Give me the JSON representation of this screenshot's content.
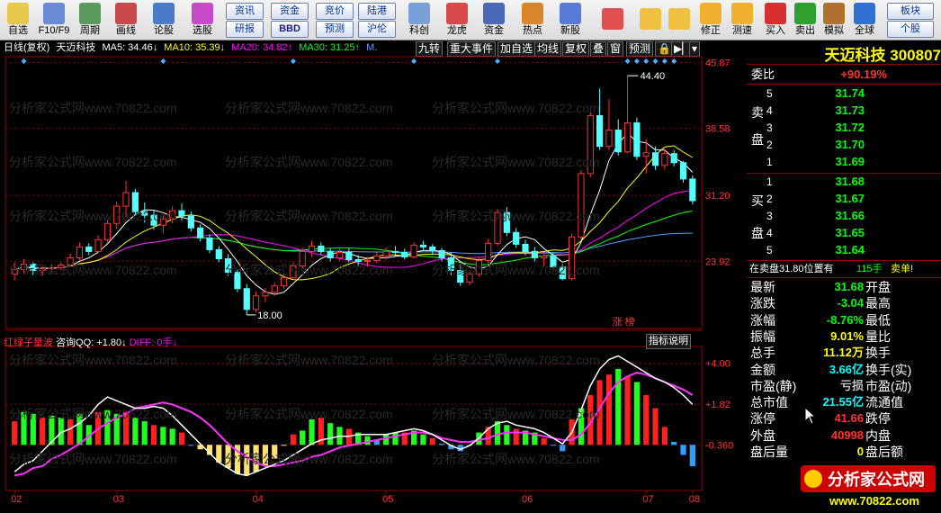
{
  "toolbar": {
    "items": [
      {
        "label": "自选",
        "icon": "grid-icon"
      },
      {
        "label": "F10/F9",
        "icon": "f10-icon"
      },
      {
        "label": "周期",
        "icon": "cycle-icon"
      },
      {
        "label": "画线",
        "icon": "pen-icon"
      },
      {
        "label": "论股",
        "icon": "discuss-icon"
      },
      {
        "label": "选股",
        "icon": "select-stock-icon"
      },
      {
        "label": "科创",
        "icon": "kechuang-icon"
      },
      {
        "label": "龙虎",
        "icon": "dragon-tiger-icon"
      },
      {
        "label": "资金",
        "icon": "pe-icon"
      },
      {
        "label": "热点",
        "icon": "hot-icon"
      },
      {
        "label": "新股",
        "icon": "ipo-icon"
      }
    ],
    "buttons_top": [
      "资讯",
      "资金",
      "竞价",
      "陆港"
    ],
    "buttons_bottom": [
      "研报",
      "BBD",
      "预测",
      "沪伦"
    ],
    "right_items": [
      {
        "label": "修正",
        "icon": "revise-icon"
      },
      {
        "label": "测速",
        "icon": "speed-icon"
      },
      {
        "label": "买入",
        "icon": "buy-icon"
      },
      {
        "label": "卖出",
        "icon": "sell-icon"
      },
      {
        "label": "模拟",
        "icon": "hammer-icon"
      },
      {
        "label": "全球",
        "icon": "globe-icon"
      }
    ],
    "right_buttons": [
      "板块",
      "个股"
    ]
  },
  "chart_header": {
    "period": "日线(复权)",
    "name": "天迈科技",
    "ma5": "MA5: 34.46↓",
    "ma10": "MA10: 35.39↓",
    "ma20": "MA20: 34.82↑",
    "ma30": "MA30: 31.25↑",
    "more": "M.",
    "tabs": [
      "九转",
      "重大事件",
      "加自选",
      "均线",
      "复权",
      "叠",
      "窗",
      "预测",
      "🔒",
      "▶▏",
      "▾"
    ]
  },
  "indicator_header": {
    "name": "红绿子量波",
    "qq": "咨询QQ: +1.80↓",
    "diff": "DIFF: 0手↓",
    "explain": "指标说明"
  },
  "colors": {
    "up": "#ff3232",
    "down": "#54ffff",
    "ma5": "#ffffff",
    "ma10": "#ffff00",
    "ma20": "#ff00ff",
    "ma30": "#00ff00",
    "ma60": "#5599ff",
    "grid": "#8b0000",
    "axis_text": "#ff3232"
  },
  "chart_data": [
    {
      "type": "candlestick",
      "title": "",
      "y_ticks": [
        45.87,
        38.58,
        31.2,
        23.92
      ],
      "ylim": [
        16.5,
        46.5
      ],
      "x_ticks": [
        "02",
        "03",
        "04",
        "05",
        "06",
        "07",
        "08"
      ],
      "annotations": [
        {
          "text": "44.40",
          "value": 44.4
        },
        {
          "text": "18.00",
          "value": 18.0
        },
        {
          "text": "涨 榜",
          "value": 0
        }
      ],
      "candles": [
        [
          22.5,
          23.8,
          21.8,
          23.0
        ],
        [
          23.0,
          24.2,
          22.6,
          23.6
        ],
        [
          23.6,
          23.8,
          22.4,
          22.9
        ],
        [
          22.9,
          23.4,
          22.3,
          23.1
        ],
        [
          23.1,
          23.6,
          22.7,
          23.2
        ],
        [
          23.2,
          23.8,
          22.9,
          23.5
        ],
        [
          23.5,
          24.8,
          23.3,
          24.3
        ],
        [
          24.3,
          26.0,
          24.0,
          25.5
        ],
        [
          25.5,
          25.9,
          24.6,
          25.0
        ],
        [
          25.0,
          26.8,
          24.8,
          26.3
        ],
        [
          26.3,
          28.5,
          26.0,
          28.1
        ],
        [
          28.1,
          30.5,
          27.5,
          30.0
        ],
        [
          30.0,
          32.8,
          28.8,
          31.5
        ],
        [
          31.5,
          31.9,
          29.0,
          29.4
        ],
        [
          29.4,
          30.4,
          28.2,
          29.0
        ],
        [
          29.0,
          29.6,
          27.4,
          27.9
        ],
        [
          27.9,
          29.0,
          27.0,
          28.6
        ],
        [
          28.6,
          30.0,
          28.1,
          29.5
        ],
        [
          29.5,
          30.3,
          28.4,
          28.9
        ],
        [
          28.9,
          29.4,
          27.2,
          27.6
        ],
        [
          27.6,
          28.0,
          26.1,
          26.5
        ],
        [
          26.5,
          26.9,
          24.8,
          25.2
        ],
        [
          25.2,
          25.6,
          23.8,
          24.2
        ],
        [
          24.2,
          24.7,
          22.3,
          22.7
        ],
        [
          22.7,
          23.0,
          20.5,
          20.9
        ],
        [
          20.9,
          21.4,
          18.0,
          18.6
        ],
        [
          18.6,
          20.6,
          18.3,
          20.1
        ],
        [
          20.1,
          21.0,
          19.4,
          20.5
        ],
        [
          20.5,
          21.6,
          20.1,
          21.2
        ],
        [
          21.2,
          22.5,
          20.9,
          22.1
        ],
        [
          22.1,
          23.8,
          21.9,
          23.4
        ],
        [
          23.4,
          25.4,
          23.1,
          25.0
        ],
        [
          25.0,
          26.2,
          24.4,
          25.6
        ],
        [
          25.6,
          26.0,
          24.6,
          25.0
        ],
        [
          25.0,
          25.4,
          23.9,
          24.3
        ],
        [
          24.3,
          25.3,
          24.0,
          24.9
        ],
        [
          24.9,
          25.4,
          23.8,
          24.1
        ],
        [
          24.1,
          24.6,
          23.4,
          23.9
        ],
        [
          23.9,
          24.4,
          23.3,
          24.0
        ],
        [
          24.0,
          24.9,
          23.7,
          24.5
        ],
        [
          24.5,
          25.4,
          24.1,
          25.0
        ],
        [
          25.0,
          25.6,
          24.5,
          24.9
        ],
        [
          24.9,
          25.3,
          24.1,
          24.4
        ],
        [
          24.4,
          26.0,
          24.2,
          25.7
        ],
        [
          25.7,
          26.2,
          25.1,
          25.5
        ],
        [
          25.5,
          25.8,
          24.6,
          25.1
        ],
        [
          25.1,
          25.4,
          23.9,
          24.3
        ],
        [
          24.3,
          24.9,
          22.4,
          22.9
        ],
        [
          22.9,
          23.6,
          21.2,
          21.6
        ],
        [
          21.6,
          22.8,
          21.3,
          22.5
        ],
        [
          22.5,
          24.4,
          22.2,
          24.0
        ],
        [
          24.0,
          26.4,
          23.7,
          25.9
        ],
        [
          25.9,
          29.7,
          25.6,
          29.3
        ],
        [
          29.3,
          29.9,
          26.7,
          27.1
        ],
        [
          27.1,
          27.6,
          25.4,
          25.8
        ],
        [
          25.8,
          26.3,
          24.6,
          25.0
        ],
        [
          25.0,
          25.5,
          23.9,
          24.3
        ],
        [
          24.3,
          24.9,
          23.4,
          24.5
        ],
        [
          24.5,
          24.8,
          23.1,
          23.3
        ],
        [
          23.3,
          23.6,
          21.8,
          22.0
        ],
        [
          22.0,
          27.0,
          21.8,
          26.6
        ],
        [
          26.6,
          34.0,
          26.3,
          33.6
        ],
        [
          33.6,
          40.5,
          33.2,
          40.0
        ],
        [
          40.0,
          43.0,
          36.2,
          36.6
        ],
        [
          36.6,
          41.8,
          36.2,
          38.4
        ],
        [
          38.4,
          39.6,
          35.6,
          36.0
        ],
        [
          36.0,
          44.4,
          35.8,
          39.2
        ],
        [
          39.2,
          39.8,
          35.1,
          35.5
        ],
        [
          35.5,
          37.4,
          33.6,
          35.9
        ],
        [
          35.9,
          36.6,
          34.0,
          34.5
        ],
        [
          34.5,
          36.4,
          34.0,
          35.8
        ],
        [
          35.8,
          36.2,
          34.4,
          34.8
        ],
        [
          34.8,
          35.0,
          32.6,
          33.0
        ],
        [
          33.0,
          33.4,
          30.2,
          30.6
        ]
      ]
    },
    {
      "type": "bar",
      "title": "",
      "y_ticks": [
        4.0,
        1.82,
        -0.36
      ],
      "ylim": [
        -2.8,
        4.9
      ],
      "x_ticks": [
        "02",
        "03",
        "04",
        "05",
        "06",
        "07",
        "08"
      ],
      "values": [
        0.9,
        1.4,
        1.3,
        1.1,
        1.2,
        1.1,
        1.0,
        1.3,
        0.7,
        1.4,
        1.5,
        1.3,
        1.4,
        1.1,
        0.9,
        0.7,
        0.6,
        0.5,
        0.3,
        -0.4,
        -0.6,
        -0.9,
        -1.3,
        -1.6,
        -1.9,
        -2.0,
        -1.8,
        -1.5,
        -1.1,
        -0.4,
        0.2,
        0.4,
        1.0,
        1.1,
        0.8,
        0.6,
        0.5,
        0.3,
        0.1,
        -0.1,
        0.2,
        0.3,
        0.3,
        0.4,
        0.2,
        0.0,
        -0.3,
        -0.6,
        -0.7,
        -0.4,
        0.3,
        0.6,
        0.9,
        0.7,
        0.5,
        0.4,
        0.3,
        0.0,
        -0.4,
        -0.7,
        1.0,
        1.6,
        2.3,
        3.1,
        3.4,
        3.7,
        3.3,
        3.0,
        2.3,
        1.6,
        0.6,
        -0.2,
        -0.9,
        -1.5
      ],
      "series": [
        {
          "name": "",
          "values": [
            -2.0,
            -1.9,
            -1.6,
            -1.5,
            -1.1,
            -0.9,
            -0.6,
            -0.3,
            0.1,
            0.5,
            0.8,
            1.1,
            1.3,
            1.6,
            1.7,
            1.8,
            1.9,
            1.8,
            1.6,
            1.4,
            1.1,
            0.7,
            0.2,
            -0.3,
            -0.7,
            -1.0,
            -1.3,
            -1.5,
            -1.5,
            -1.4,
            -1.3,
            -1.2,
            -1.0,
            -0.9,
            -0.7,
            -0.5,
            -0.4,
            -0.3,
            -0.2,
            -0.1,
            0.0,
            0.1,
            0.2,
            0.3,
            0.3,
            0.2,
            0.0,
            -0.1,
            -0.2,
            -0.2,
            -0.1,
            0.0,
            0.2,
            0.3,
            0.3,
            0.3,
            0.2,
            0.1,
            0.0,
            -0.1,
            -0.1,
            0.2,
            0.8,
            1.6,
            2.4,
            3.0,
            3.3,
            3.5,
            3.4,
            3.2,
            3.0,
            2.8,
            2.6,
            2.3
          ]
        },
        {
          "name": "",
          "values": [
            -1.8,
            -1.4,
            -1.2,
            -0.7,
            -0.2,
            0.3,
            0.5,
            0.8,
            1.2,
            1.8,
            2.2,
            2.0,
            1.8,
            1.6,
            1.6,
            1.7,
            1.6,
            1.2,
            0.7,
            0.2,
            -0.3,
            -0.8,
            -1.3,
            -1.6,
            -1.9,
            -2.0,
            -1.8,
            -1.6,
            -1.4,
            -1.2,
            -0.9,
            -0.6,
            -0.3,
            -0.1,
            0.0,
            0.1,
            0.1,
            0.2,
            0.2,
            0.2,
            0.2,
            0.3,
            0.4,
            0.5,
            0.4,
            0.2,
            -0.1,
            -0.4,
            -0.6,
            -0.4,
            0.0,
            0.5,
            0.8,
            0.9,
            0.7,
            0.6,
            0.5,
            0.3,
            0.0,
            -0.3,
            0.3,
            1.5,
            2.8,
            3.7,
            4.2,
            4.4,
            4.1,
            3.8,
            3.5,
            3.2,
            3.0,
            2.7,
            2.3,
            1.8
          ]
        }
      ]
    }
  ],
  "right_panel": {
    "title": "天迈科技 300807",
    "weibi_label": "委比",
    "weibi_value": "+90.19%",
    "sell_side": [
      "卖",
      "盘"
    ],
    "buy_side": [
      "买",
      "盘"
    ],
    "asks": [
      {
        "level": "5",
        "price": "31.74"
      },
      {
        "level": "4",
        "price": "31.73"
      },
      {
        "level": "3",
        "price": "31.72"
      },
      {
        "level": "2",
        "price": "31.70"
      },
      {
        "level": "1",
        "price": "31.69"
      }
    ],
    "bids": [
      {
        "level": "1",
        "price": "31.68"
      },
      {
        "level": "2",
        "price": "31.67"
      },
      {
        "level": "3",
        "price": "31.66"
      },
      {
        "level": "4",
        "price": "31.65"
      },
      {
        "level": "5",
        "price": "31.64"
      }
    ],
    "pending_text": "在卖盘31.80位置有",
    "pending_qty": "115手",
    "pending_tag": "卖单!",
    "stats": [
      {
        "l": "最新",
        "v": "31.68",
        "r": "开盘",
        "c": "#00ff00"
      },
      {
        "l": "涨跌",
        "v": "-3.04",
        "r": "最高",
        "c": "#00ff00"
      },
      {
        "l": "涨幅",
        "v": "-8.76%",
        "r": "最低",
        "c": "#00ff00"
      },
      {
        "l": "振幅",
        "v": "9.01%",
        "r": "量比",
        "c": "#ffff00"
      },
      {
        "l": "总手",
        "v": "11.12万",
        "r": "换手",
        "c": "#ffff00"
      },
      {
        "l": "金额",
        "v": "3.66亿",
        "r": "换手(实)",
        "c": "#00ffff"
      },
      {
        "l": "市盈(静)",
        "v": "亏损",
        "r": "市盈(动)",
        "c": "#c0c0c0"
      },
      {
        "l": "总市值",
        "v": "21.55亿",
        "r": "流通值",
        "c": "#00ffff"
      },
      {
        "l": "涨停",
        "v": "41.66",
        "r": "跌停",
        "c": "#ff3232"
      },
      {
        "l": "外盘",
        "v": "40998",
        "r": "内盘",
        "c": "#ff3232"
      },
      {
        "l": "盘后量",
        "v": "0",
        "r": "盘后额",
        "c": "#ffff00"
      }
    ],
    "logo_text": "分析家公式网",
    "logo_url": "www.70822.com"
  },
  "watermark": "分析家公式网www.70822.com"
}
